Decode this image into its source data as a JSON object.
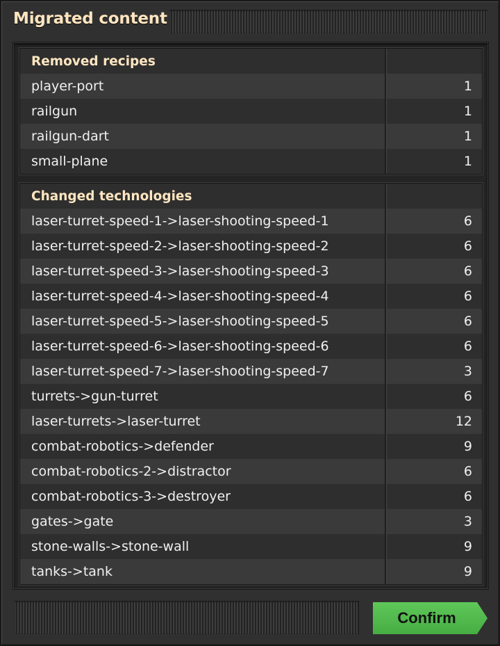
{
  "window": {
    "title": "Migrated content"
  },
  "groups": [
    {
      "header": "Removed recipes",
      "rows": [
        {
          "name": "player-port",
          "count": "1"
        },
        {
          "name": "railgun",
          "count": "1"
        },
        {
          "name": "railgun-dart",
          "count": "1"
        },
        {
          "name": "small-plane",
          "count": "1"
        }
      ]
    },
    {
      "header": "Changed technologies",
      "rows": [
        {
          "name": "laser-turret-speed-1->laser-shooting-speed-1",
          "count": "6"
        },
        {
          "name": "laser-turret-speed-2->laser-shooting-speed-2",
          "count": "6"
        },
        {
          "name": "laser-turret-speed-3->laser-shooting-speed-3",
          "count": "6"
        },
        {
          "name": "laser-turret-speed-4->laser-shooting-speed-4",
          "count": "6"
        },
        {
          "name": "laser-turret-speed-5->laser-shooting-speed-5",
          "count": "6"
        },
        {
          "name": "laser-turret-speed-6->laser-shooting-speed-6",
          "count": "6"
        },
        {
          "name": "laser-turret-speed-7->laser-shooting-speed-7",
          "count": "3"
        },
        {
          "name": "turrets->gun-turret",
          "count": "6"
        },
        {
          "name": "laser-turrets->laser-turret",
          "count": "12"
        },
        {
          "name": "combat-robotics->defender",
          "count": "9"
        },
        {
          "name": "combat-robotics-2->distractor",
          "count": "6"
        },
        {
          "name": "combat-robotics-3->destroyer",
          "count": "6"
        },
        {
          "name": "gates->gate",
          "count": "3"
        },
        {
          "name": "stone-walls->stone-wall",
          "count": "9"
        },
        {
          "name": "tanks->tank",
          "count": "9"
        }
      ]
    }
  ],
  "footer": {
    "confirm_label": "Confirm"
  },
  "colors": {
    "title": "#ffe6c0",
    "confirm": "#52b94d",
    "panel": "#313031"
  }
}
